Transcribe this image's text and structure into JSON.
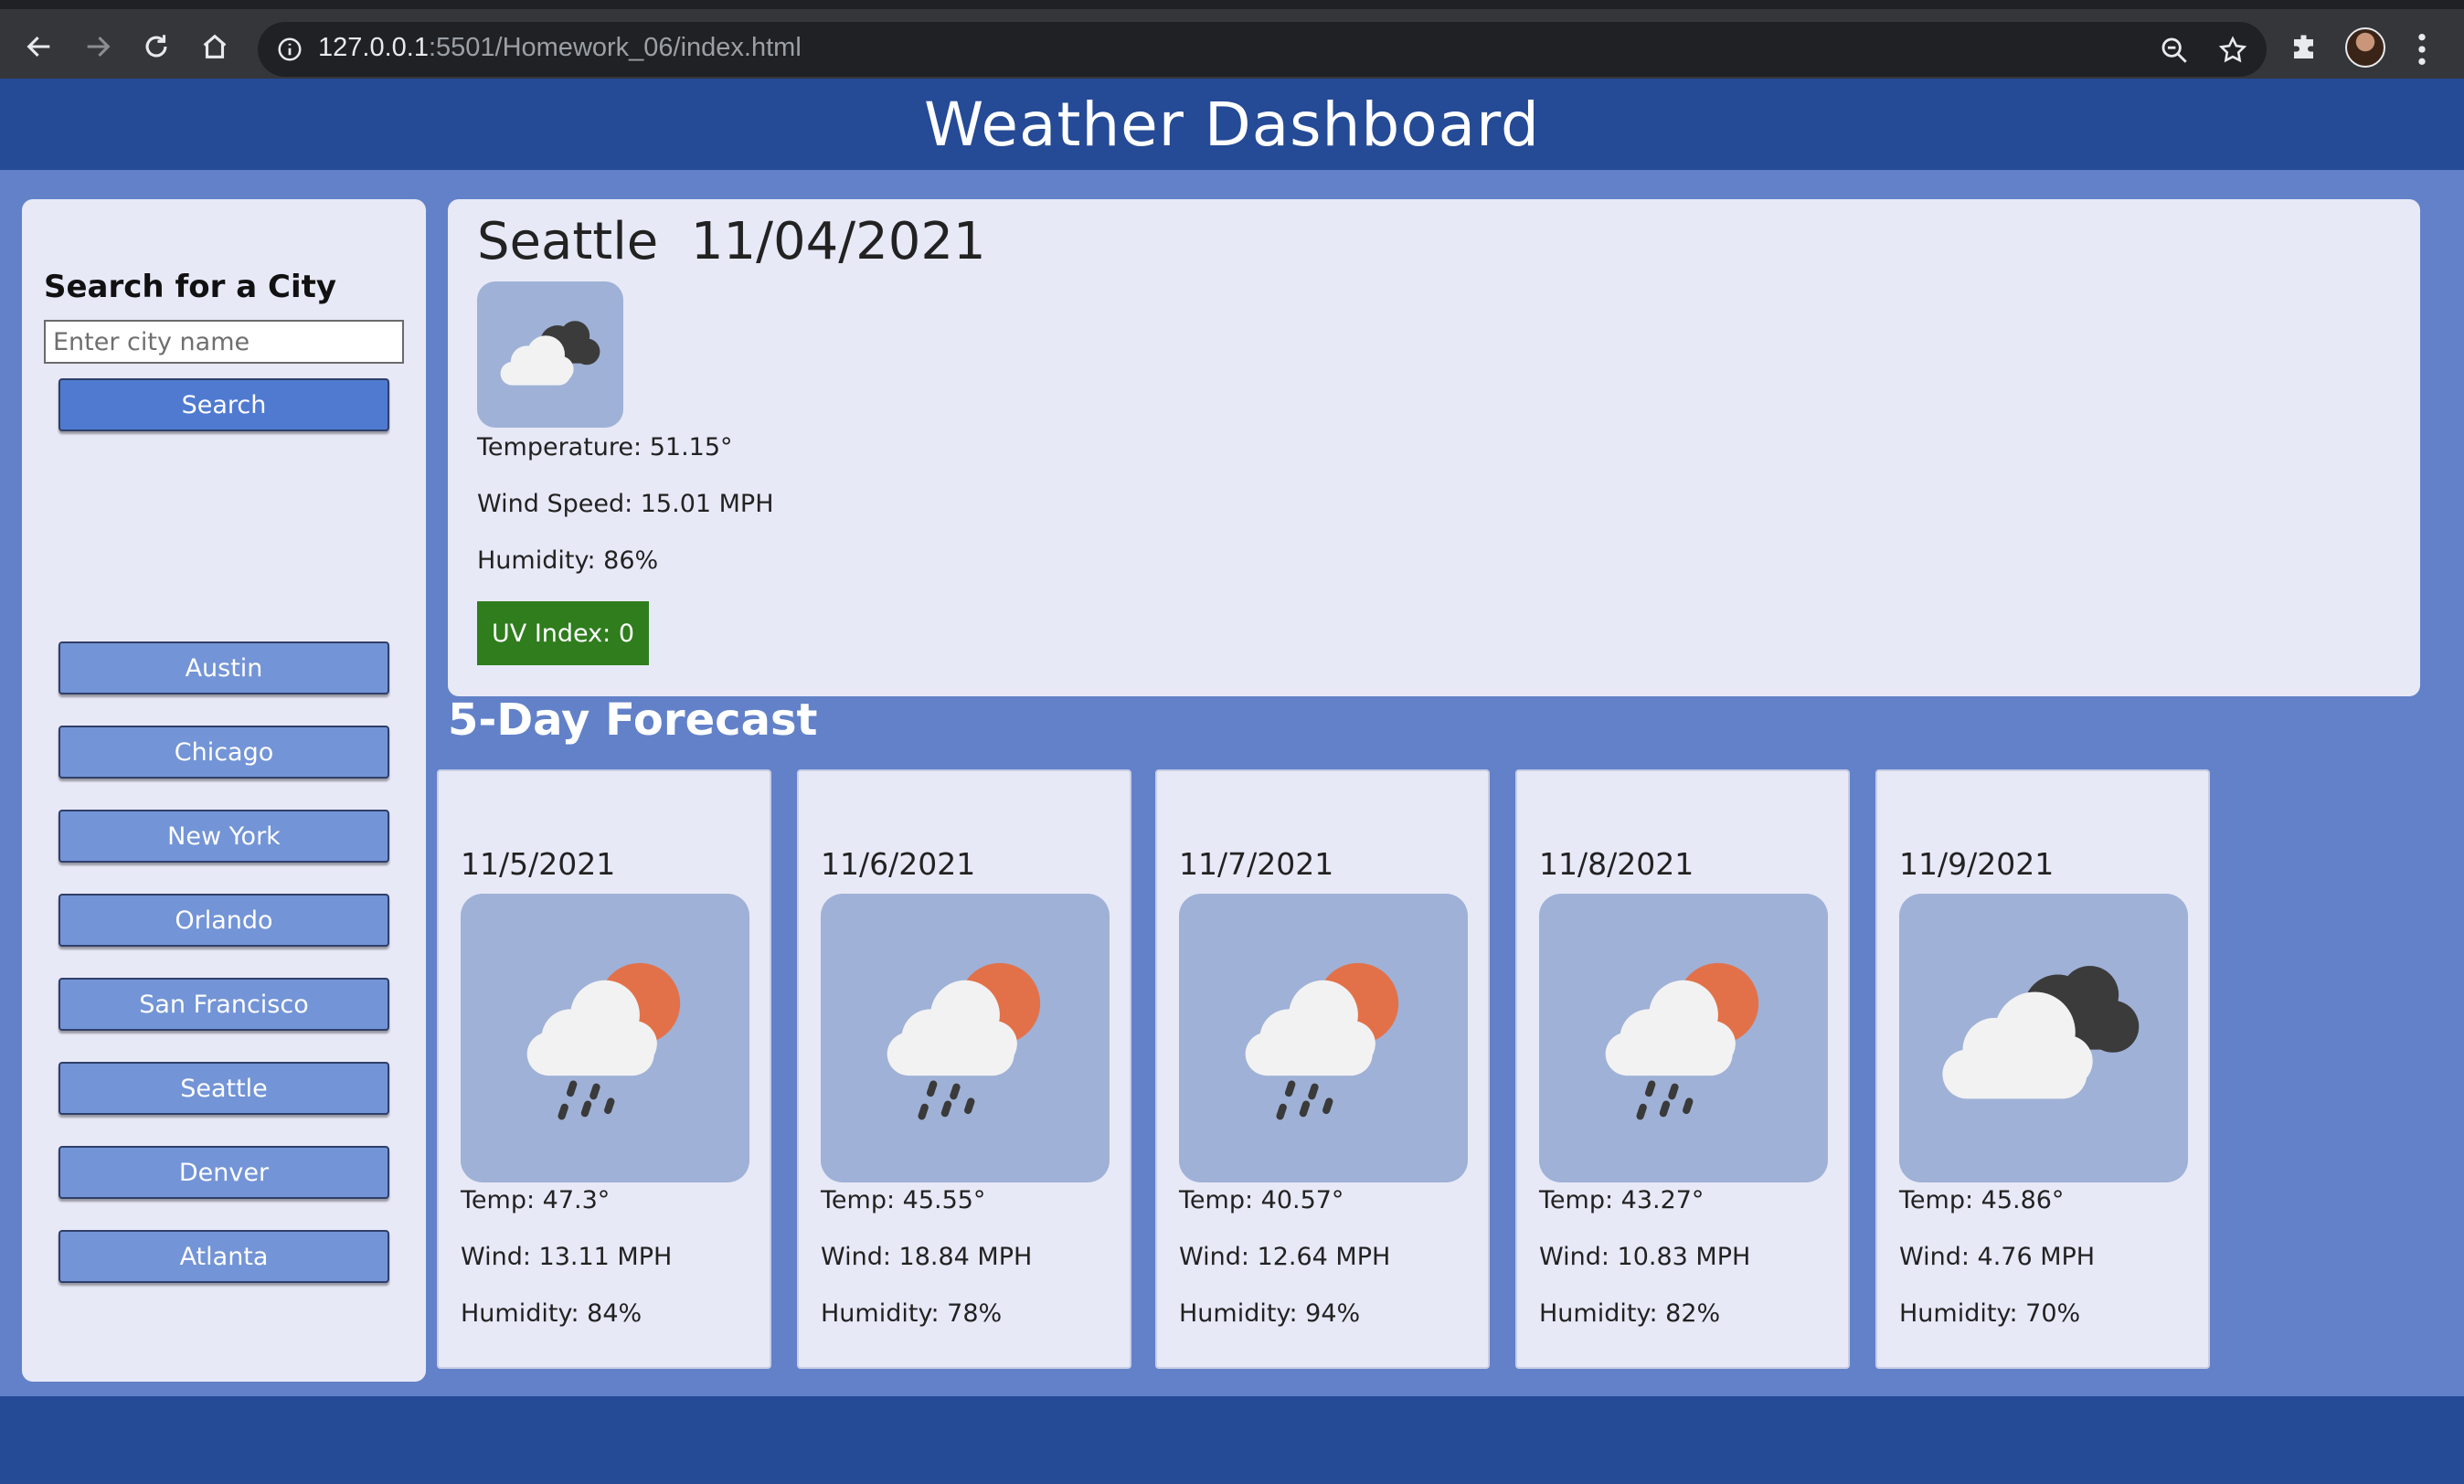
{
  "browser": {
    "url_host": "127.0.0.1",
    "url_rest": ":5501/Homework_06/index.html"
  },
  "header": {
    "title": "Weather Dashboard"
  },
  "sidebar": {
    "heading": "Search for a City",
    "input_placeholder": "Enter city name",
    "search_label": "Search",
    "history": [
      "Austin",
      "Chicago",
      "New York",
      "Orlando",
      "San Francisco",
      "Seattle",
      "Denver",
      "Atlanta"
    ]
  },
  "current": {
    "city": "Seattle",
    "date": "11/04/2021",
    "icon": "cloudy-icon",
    "temperature": "Temperature: 51.15°",
    "wind": "Wind Speed: 15.01 MPH",
    "humidity": "Humidity: 86%",
    "uv": "UV Index: 0",
    "uv_color": "#2f7d1d"
  },
  "forecast": {
    "title": "5-Day Forecast",
    "days": [
      {
        "date": "11/5/2021",
        "icon": "rain-sun-icon",
        "temp": "Temp: 47.3°",
        "wind": "Wind: 13.11 MPH",
        "humidity": "Humidity: 84%"
      },
      {
        "date": "11/6/2021",
        "icon": "rain-sun-icon",
        "temp": "Temp: 45.55°",
        "wind": "Wind: 18.84 MPH",
        "humidity": "Humidity: 78%"
      },
      {
        "date": "11/7/2021",
        "icon": "rain-sun-icon",
        "temp": "Temp: 40.57°",
        "wind": "Wind: 12.64 MPH",
        "humidity": "Humidity: 94%"
      },
      {
        "date": "11/8/2021",
        "icon": "rain-sun-icon",
        "temp": "Temp: 43.27°",
        "wind": "Wind: 10.83 MPH",
        "humidity": "Humidity: 82%"
      },
      {
        "date": "11/9/2021",
        "icon": "cloudy-icon",
        "temp": "Temp: 45.86°",
        "wind": "Wind: 4.76 MPH",
        "humidity": "Humidity: 70%"
      }
    ]
  },
  "colors": {
    "header_bg": "#254a96",
    "page_bg": "#6281c8",
    "card_bg": "#e8e9f7",
    "button": "#4f7ad0",
    "history_button": "#7394d6"
  }
}
